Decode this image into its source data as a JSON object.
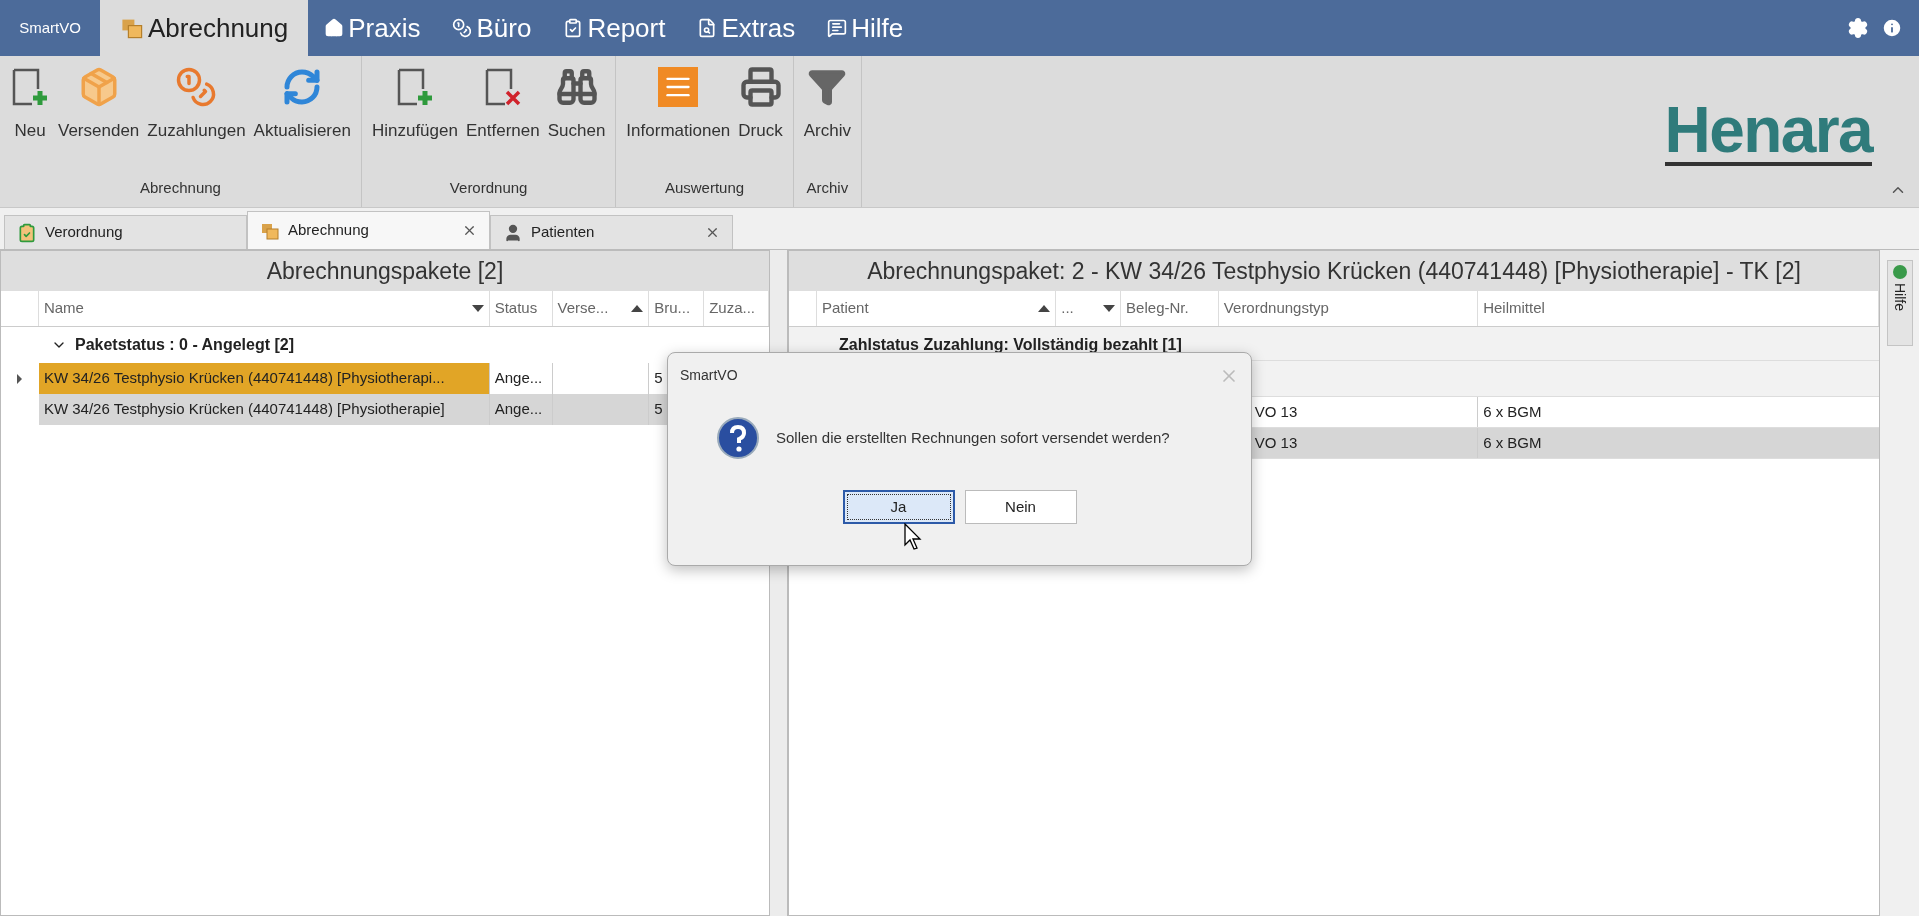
{
  "app_menu": "SmartVO",
  "main_tabs": [
    {
      "label": "Abrechnung",
      "kind": "billing",
      "selected": true
    },
    {
      "label": "Praxis",
      "kind": "practice",
      "selected": false
    },
    {
      "label": "Büro",
      "kind": "office",
      "selected": false
    },
    {
      "label": "Report",
      "kind": "report",
      "selected": false
    },
    {
      "label": "Extras",
      "kind": "extras",
      "selected": false
    },
    {
      "label": "Hilfe",
      "kind": "help",
      "selected": false
    }
  ],
  "ribbon": {
    "groups": [
      {
        "label": "Abrechnung",
        "buttons": [
          {
            "label": "Neu",
            "kind": "new"
          },
          {
            "label": "Versenden",
            "kind": "send"
          },
          {
            "label": "Zuzahlungen",
            "kind": "payments"
          },
          {
            "label": "Aktualisieren",
            "kind": "refresh"
          }
        ]
      },
      {
        "label": "Verordnung",
        "buttons": [
          {
            "label": "Hinzufügen",
            "kind": "add"
          },
          {
            "label": "Entfernen",
            "kind": "remove"
          },
          {
            "label": "Suchen",
            "kind": "search"
          }
        ]
      },
      {
        "label": "Auswertung",
        "buttons": [
          {
            "label": "Informationen",
            "kind": "info"
          },
          {
            "label": "Druck",
            "kind": "print"
          }
        ]
      },
      {
        "label": "Archiv",
        "buttons": [
          {
            "label": "Archiv",
            "kind": "filter"
          }
        ]
      }
    ]
  },
  "logo": "Henara",
  "doc_tabs": [
    {
      "label": "Verordnung",
      "kind": "prescription",
      "selected": false,
      "closable": false
    },
    {
      "label": "Abrechnung",
      "kind": "billing",
      "selected": true,
      "closable": true
    },
    {
      "label": "Patienten",
      "kind": "patients",
      "selected": false,
      "closable": true
    }
  ],
  "left_panel": {
    "title": "Abrechnungspakete [2]",
    "columns": [
      {
        "label": "Name",
        "kind": "descending"
      },
      {
        "label": "Status",
        "kind": "plain"
      },
      {
        "label": "Verse...",
        "kind": "ascending"
      },
      {
        "label": "Bru...",
        "kind": "plain"
      },
      {
        "label": "Zuza...",
        "kind": "plain"
      }
    ],
    "group": {
      "label": "Paketstatus : 0 - Angelegt [2]",
      "expanded": true
    },
    "rows": [
      {
        "focused": true,
        "selected": true,
        "name": "KW 34/26  Testphysio Krücken (440741448) [Physiotherapi...",
        "status": "Ange...",
        "column_4": "5"
      },
      {
        "focused": false,
        "selected": true,
        "name": "KW 34/26  Testphysio Krücken (440741448) [Physiotherapie]",
        "status": "Ange...",
        "column_4": "5"
      }
    ]
  },
  "right_panel": {
    "title": "Abrechnungspaket: 2 - KW 34/26  Testphysio Krücken (440741448) [Physiotherapie] - TK [2]",
    "columns": [
      {
        "label": "Patient",
        "kind": "ascending"
      },
      {
        "label": "...",
        "kind": "descending"
      },
      {
        "label": "Beleg-Nr.",
        "kind": "plain"
      },
      {
        "label": "Verordnungstyp",
        "kind": "plain"
      },
      {
        "label": "Heilmittel",
        "kind": "plain"
      }
    ],
    "group": {
      "label": "Zahlstatus Zuzahlung: Vollständig bezahlt [1]"
    },
    "rows": [
      {
        "selected": false,
        "verordnungstyp": "VO 13",
        "heilmittel": "6 x BGM"
      },
      {
        "selected": true,
        "verordnungstyp": "VO 13",
        "heilmittel": "6 x BGM"
      }
    ]
  },
  "side_tab": "Hilfe",
  "dialog": {
    "title": "SmartVO",
    "message": "Sollen die erstellten Rechnungen sofort versendet werden?",
    "buttons": [
      {
        "label": "Ja",
        "focused": true
      },
      {
        "label": "Nein",
        "focused": false
      }
    ]
  }
}
